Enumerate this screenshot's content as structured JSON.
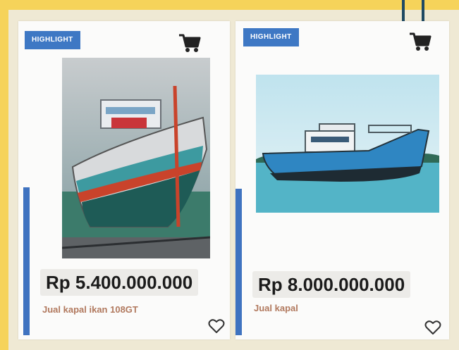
{
  "products": [
    {
      "badge": "HIGHLIGHT",
      "price": "Rp 5.400.000.000",
      "title": "Jual kapal ikan 108GT",
      "cart_icon": "cart-icon",
      "favorite_icon": "heart-icon"
    },
    {
      "badge": "HIGHLIGHT",
      "price": "Rp 8.000.000.000",
      "title": "Jual kapal",
      "cart_icon": "cart-icon",
      "favorite_icon": "heart-icon"
    }
  ],
  "colors": {
    "background": "#f6d35a",
    "badge": "#3e78c4",
    "accent_bar": "#3f73c0",
    "title_text": "#b1795e",
    "clip": "#1f4a63"
  }
}
